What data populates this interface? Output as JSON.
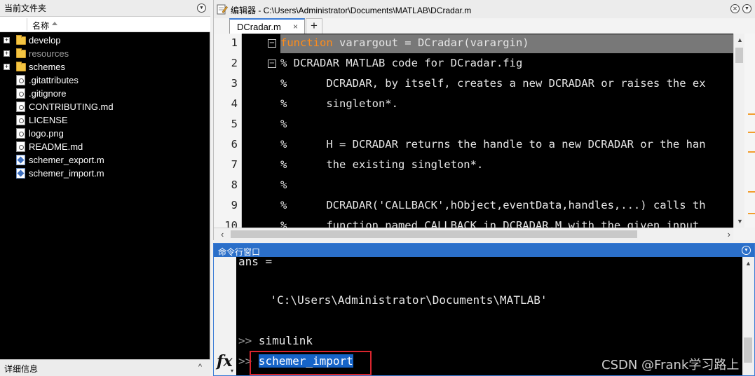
{
  "folder_panel": {
    "title": "当前文件夹",
    "column_name": "名称",
    "items": [
      {
        "name": "develop",
        "type": "folder",
        "expandable": true
      },
      {
        "name": "resources",
        "type": "folder",
        "expandable": true,
        "dim": true
      },
      {
        "name": "schemes",
        "type": "folder",
        "expandable": true
      },
      {
        "name": ".gitattributes",
        "type": "file"
      },
      {
        "name": ".gitignore",
        "type": "file"
      },
      {
        "name": "CONTRIBUTING.md",
        "type": "file"
      },
      {
        "name": "LICENSE",
        "type": "file"
      },
      {
        "name": "logo.png",
        "type": "file"
      },
      {
        "name": "README.md",
        "type": "file"
      },
      {
        "name": "schemer_export.m",
        "type": "mfile"
      },
      {
        "name": "schemer_import.m",
        "type": "mfile"
      }
    ],
    "details_label": "详细信息",
    "details_caret": "^"
  },
  "editor": {
    "title": "编辑器 - C:\\Users\\Administrator\\Documents\\MATLAB\\DCradar.m",
    "tab_label": "DCradar.m",
    "tab_close": "×",
    "tab_add": "+",
    "lines": [
      {
        "num": "1",
        "fold": "−",
        "kw": "function",
        "rest": " varargout = DCradar(varargin)",
        "highlight": true
      },
      {
        "num": "2",
        "fold": "−",
        "text": "% DCRADAR MATLAB code for DCradar.fig"
      },
      {
        "num": "3",
        "text": "%      DCRADAR, by itself, creates a new DCRADAR or raises the ex"
      },
      {
        "num": "4",
        "text": "%      singleton*."
      },
      {
        "num": "5",
        "text": "%"
      },
      {
        "num": "6",
        "text": "%      H = DCRADAR returns the handle to a new DCRADAR or the han"
      },
      {
        "num": "7",
        "text": "%      the existing singleton*."
      },
      {
        "num": "8",
        "text": "%"
      },
      {
        "num": "9",
        "text": "%      DCRADAR('CALLBACK',hObject,eventData,handles,...) calls th"
      },
      {
        "num": "10",
        "text": "%      function named CALLBACK in DCRADAR.M with the given input"
      }
    ]
  },
  "command_window": {
    "title": "命令行窗口",
    "lines": [
      {
        "text": "ans ="
      },
      {
        "text": "    'C:\\Users\\Administrator\\Documents\\MATLAB'"
      },
      {
        "prompt": ">>",
        "text": " simulink"
      }
    ],
    "current_prompt": ">>",
    "current_input": "schemer_import",
    "fx_label": "fx",
    "fx_caret": "▾"
  },
  "watermark": "CSDN @Frank学习路上",
  "colors": {
    "accent": "#2b6fc9",
    "selection": "#1664c8",
    "keyword": "#ff8c1a",
    "highlight_box": "#d9252e"
  }
}
